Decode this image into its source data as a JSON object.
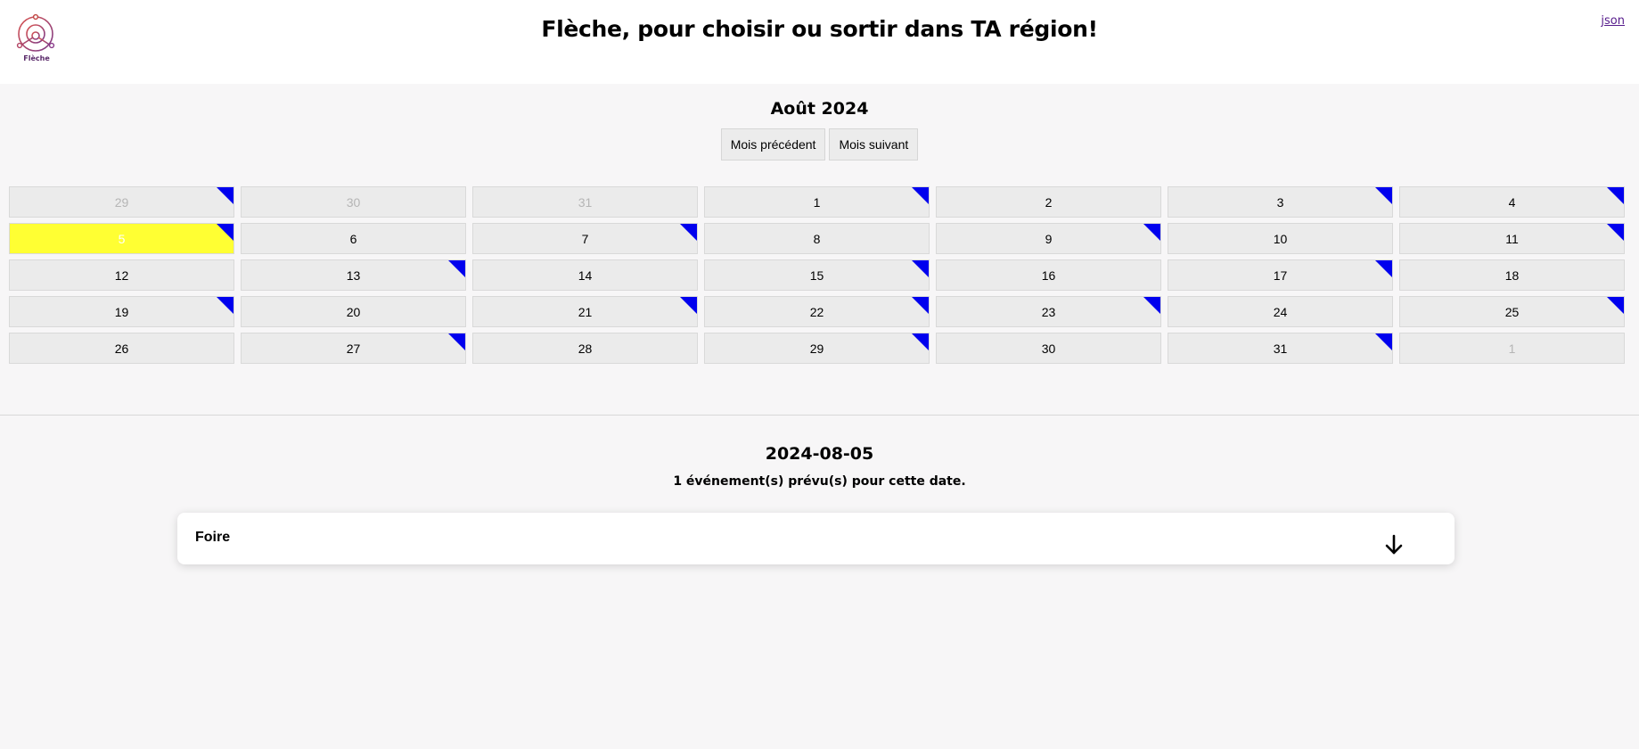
{
  "header": {
    "logo_text": "Flèche",
    "title": "Flèche, pour choisir ou sortir dans TA région!",
    "json_link": "json"
  },
  "calendar": {
    "month_title": "Août 2024",
    "prev_label": "Mois précédent",
    "next_label": "Mois suivant",
    "event_marker_color": "#0000ee",
    "selected_color": "#ffff33",
    "days": [
      {
        "label": "29",
        "other": true,
        "event": true
      },
      {
        "label": "30",
        "other": true,
        "event": false
      },
      {
        "label": "31",
        "other": true,
        "event": false
      },
      {
        "label": "1",
        "other": false,
        "event": true
      },
      {
        "label": "2",
        "other": false,
        "event": false
      },
      {
        "label": "3",
        "other": false,
        "event": true
      },
      {
        "label": "4",
        "other": false,
        "event": true
      },
      {
        "label": "5",
        "other": false,
        "event": true,
        "selected": true
      },
      {
        "label": "6",
        "other": false,
        "event": false
      },
      {
        "label": "7",
        "other": false,
        "event": true
      },
      {
        "label": "8",
        "other": false,
        "event": false
      },
      {
        "label": "9",
        "other": false,
        "event": true
      },
      {
        "label": "10",
        "other": false,
        "event": false
      },
      {
        "label": "11",
        "other": false,
        "event": true
      },
      {
        "label": "12",
        "other": false,
        "event": false
      },
      {
        "label": "13",
        "other": false,
        "event": true
      },
      {
        "label": "14",
        "other": false,
        "event": false
      },
      {
        "label": "15",
        "other": false,
        "event": true
      },
      {
        "label": "16",
        "other": false,
        "event": false
      },
      {
        "label": "17",
        "other": false,
        "event": true
      },
      {
        "label": "18",
        "other": false,
        "event": false
      },
      {
        "label": "19",
        "other": false,
        "event": true
      },
      {
        "label": "20",
        "other": false,
        "event": false
      },
      {
        "label": "21",
        "other": false,
        "event": true
      },
      {
        "label": "22",
        "other": false,
        "event": true
      },
      {
        "label": "23",
        "other": false,
        "event": true
      },
      {
        "label": "24",
        "other": false,
        "event": false
      },
      {
        "label": "25",
        "other": false,
        "event": true
      },
      {
        "label": "26",
        "other": false,
        "event": false
      },
      {
        "label": "27",
        "other": false,
        "event": true
      },
      {
        "label": "28",
        "other": false,
        "event": false
      },
      {
        "label": "29",
        "other": false,
        "event": true
      },
      {
        "label": "30",
        "other": false,
        "event": false
      },
      {
        "label": "31",
        "other": false,
        "event": true
      },
      {
        "label": "1",
        "other": true,
        "event": false
      }
    ]
  },
  "detail": {
    "date": "2024-08-05",
    "count_text": "1 événement(s) prévu(s) pour cette date.",
    "events": [
      {
        "name": "Foire",
        "icon": "arrow-down-icon"
      }
    ]
  }
}
